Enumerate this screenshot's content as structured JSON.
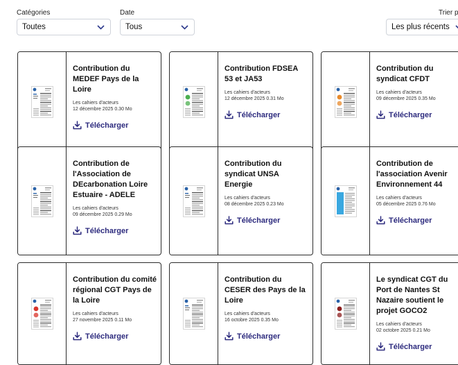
{
  "filters": {
    "category": {
      "label": "Catégories",
      "value": "Toutes"
    },
    "date": {
      "label": "Date",
      "value": "Tous"
    },
    "sort": {
      "label": "Trier p",
      "value": "Les plus récents"
    }
  },
  "download_label": "Télécharger",
  "cards": [
    {
      "title": "Contribution du MEDEF Pays de la Loire",
      "category": "Les cahiers d'acteurs",
      "date": "12 décembre 2025",
      "size": "0.30 Mo",
      "thumb": "doc-plain"
    },
    {
      "title": "Contribution FDSEA 53 et JA53",
      "category": "Les cahiers d'acteurs",
      "date": "12 décembre 2025",
      "size": "0.31 Mo",
      "thumb": "doc-green"
    },
    {
      "title": "Contribution du syndicat CFDT",
      "category": "Les cahiers d'acteurs",
      "date": "09 décembre 2025",
      "size": "0.35 Mo",
      "thumb": "doc-orange"
    },
    {
      "title": "Contribution de l'Association de DEcarbonation Loire Estuaire - ADELE",
      "category": "Les cahiers d'acteurs",
      "date": "09 décembre 2025",
      "size": "0.29 Mo",
      "thumb": "doc-plain"
    },
    {
      "title": "Contribution du syndicat UNSA Energie",
      "category": "Les cahiers d'acteurs",
      "date": "08 décembre 2025",
      "size": "0.23 Mo",
      "thumb": "doc-plain"
    },
    {
      "title": "Contribution de l'association Avenir Environnement 44",
      "category": "Les cahiers d'acteurs",
      "date": "05 décembre 2025",
      "size": "0.76 Mo",
      "thumb": "doc-blue"
    },
    {
      "title": "Contribution du comité régional CGT Pays de la Loire",
      "category": "Les cahiers d'acteurs",
      "date": "27 novembre 2025",
      "size": "0.11 Mo",
      "thumb": "doc-red"
    },
    {
      "title": "Contribution du CESER des Pays de la Loire",
      "category": "Les cahiers d'acteurs",
      "date": "16 octobre 2025",
      "size": "0.35 Mo",
      "thumb": "doc-plain"
    },
    {
      "title": "Le syndicat CGT du Port de Nantes St Nazaire soutient le projet GOCO2",
      "category": "Les cahiers d'acteurs",
      "date": "02 octobre 2025",
      "size": "0.21 Mo",
      "thumb": "doc-darkred"
    }
  ]
}
